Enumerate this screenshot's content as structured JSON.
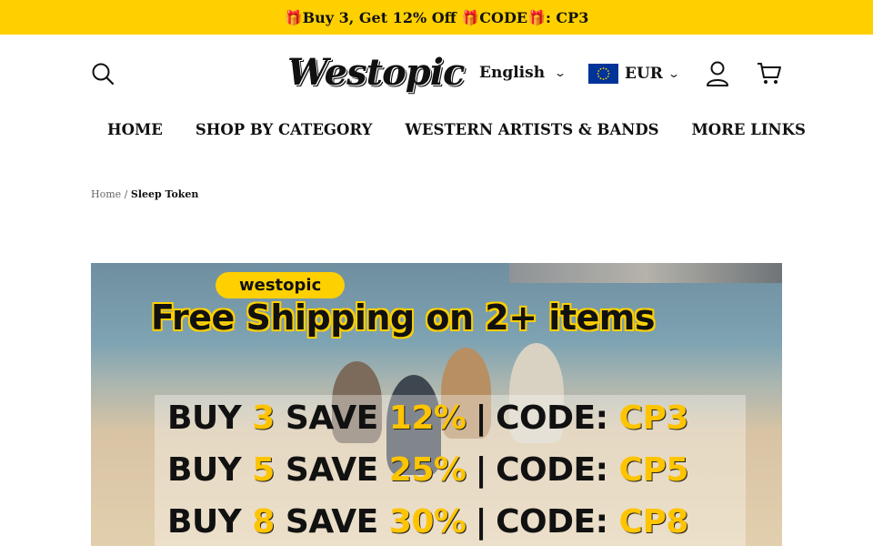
{
  "announcement": {
    "text": "🎁Buy 3, Get 12% Off 🎁CODE🎁: CP3"
  },
  "header": {
    "logo": "Westopic",
    "language": "English",
    "currency": "EUR"
  },
  "nav": {
    "items": [
      "HOME",
      "SHOP BY CATEGORY",
      "WESTERN ARTISTS & BANDS",
      "MORE LINKS"
    ]
  },
  "breadcrumb": {
    "home": "Home",
    "separator": "/",
    "current": "Sleep Token"
  },
  "banner": {
    "brand_pill": "westopic",
    "headline": "Free Shipping on 2+ items",
    "offers": [
      {
        "buy": "BUY",
        "qty": "3",
        "save": "SAVE",
        "pct": "12%",
        "code_label": "CODE:",
        "code": "CP3"
      },
      {
        "buy": "BUY",
        "qty": "5",
        "save": "SAVE",
        "pct": "25%",
        "code_label": "CODE:",
        "code": "CP5"
      },
      {
        "buy": "BUY",
        "qty": "8",
        "save": "SAVE",
        "pct": "30%",
        "code_label": "CODE:",
        "code": "CP8"
      }
    ]
  },
  "colors": {
    "accent": "#ffd000",
    "text": "#111111",
    "flag": "#003399"
  }
}
